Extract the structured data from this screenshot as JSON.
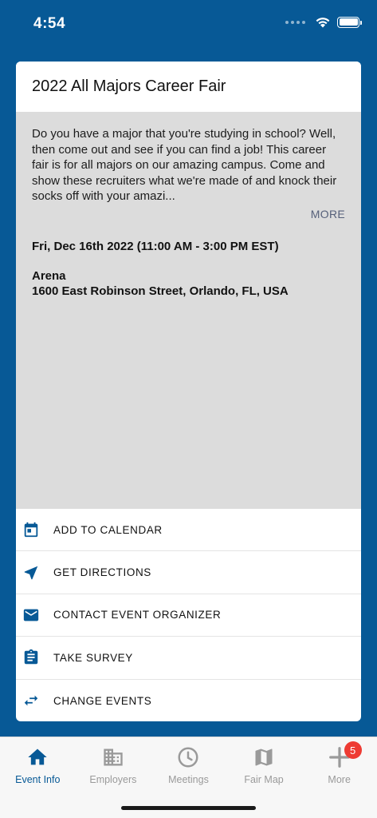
{
  "status_bar": {
    "time": "4:54"
  },
  "event": {
    "title": "2022 All Majors Career Fair",
    "description": "Do you have a major that you're studying in school? Well, then come out and see if you can find a job! This career fair is for all majors on our amazing campus. Come and show these recruiters what we're made of and knock their socks off with your amazi...",
    "more_label": "MORE",
    "date": "Fri, Dec 16th 2022 (11:00 AM - 3:00 PM EST)",
    "venue_name": "Arena",
    "venue_address": "1600 East Robinson Street, Orlando, FL, USA"
  },
  "actions": [
    {
      "label": "ADD TO CALENDAR",
      "icon": "calendar-icon"
    },
    {
      "label": "GET DIRECTIONS",
      "icon": "navigation-icon"
    },
    {
      "label": "CONTACT EVENT ORGANIZER",
      "icon": "mail-icon"
    },
    {
      "label": "TAKE SURVEY",
      "icon": "clipboard-icon"
    },
    {
      "label": "CHANGE EVENTS",
      "icon": "swap-icon"
    }
  ],
  "tabs": [
    {
      "label": "Event Info",
      "icon": "home-icon",
      "active": true
    },
    {
      "label": "Employers",
      "icon": "building-icon"
    },
    {
      "label": "Meetings",
      "icon": "clock-icon"
    },
    {
      "label": "Fair Map",
      "icon": "map-icon"
    },
    {
      "label": "More",
      "icon": "plus-icon",
      "badge": "5"
    }
  ],
  "colors": {
    "brand": "#075996",
    "badge": "#ee3b33",
    "inactive_tab": "#9a9a9a"
  }
}
